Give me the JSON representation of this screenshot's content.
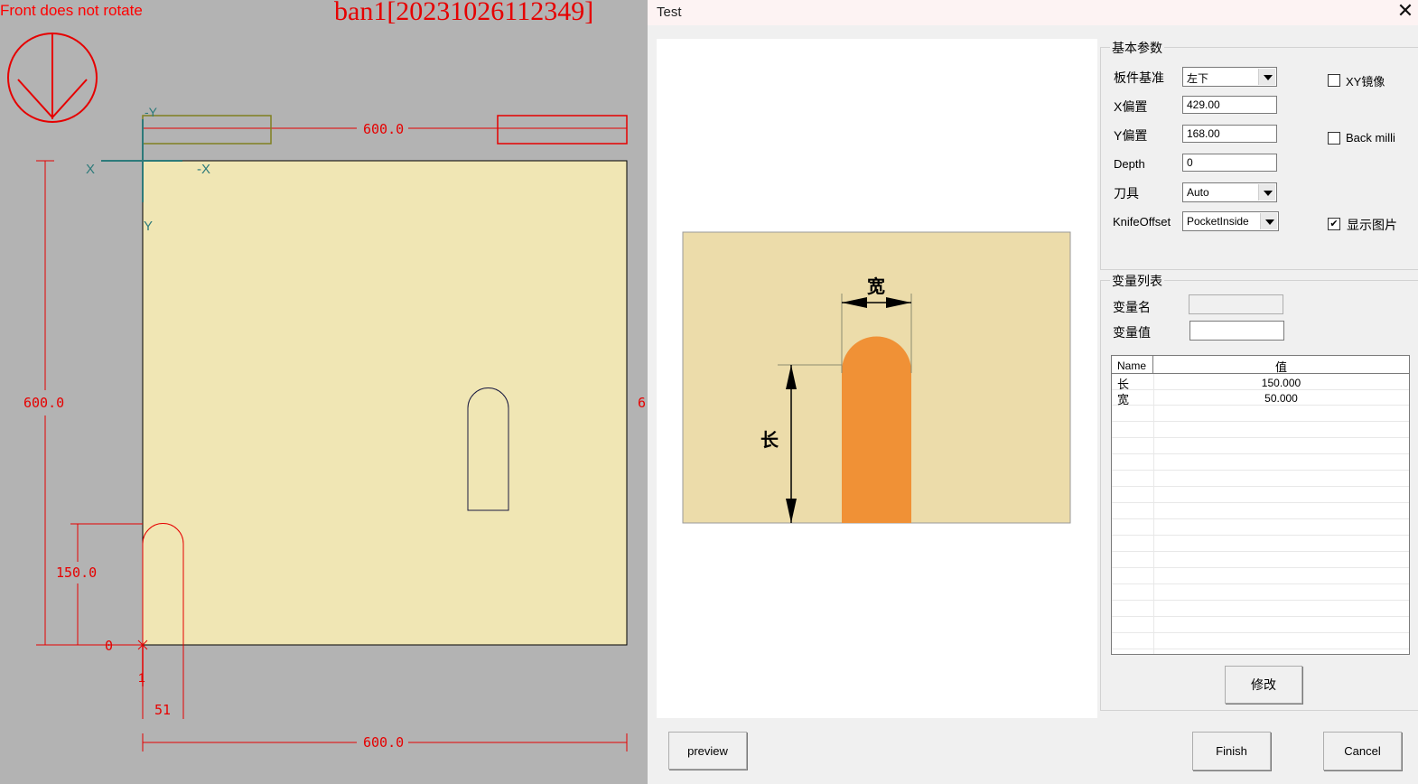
{
  "canvas": {
    "top_note": "Front does not rotate",
    "title": "ban1[20231026112349]",
    "axis": {
      "neg_y": "-Y",
      "x": "X",
      "neg_x": "-X",
      "y": "Y"
    },
    "dims": {
      "top_width": "600.0",
      "left_height": "600.0",
      "slot_height": "150.0",
      "origin": "0",
      "slot_x": "51",
      "bottom_width": "600.0",
      "right_partial": "6",
      "small_mark": "1"
    },
    "colors": {
      "panel": "#f0e6b4",
      "dim": "#e60000",
      "axis": "#2d7a7a",
      "tool": "#808020"
    }
  },
  "dialog": {
    "title": "Test",
    "preview_labels": {
      "width": "宽",
      "length": "长"
    },
    "preview_colors": {
      "bg": "#ecdcaa",
      "slot": "#f09136"
    },
    "basic_params": {
      "legend": "基本参数",
      "board_ref_label": "板件基准",
      "board_ref_value": "左下",
      "x_offset_label": "X偏置",
      "x_offset_value": "429.00",
      "y_offset_label": "Y偏置",
      "y_offset_value": "168.00",
      "depth_label": "Depth",
      "depth_value": "0",
      "tool_label": "刀具",
      "tool_value": "Auto",
      "knife_offset_label": "KnifeOffset",
      "knife_offset_value": "PocketInside",
      "xy_mirror_label": "XY镜像",
      "xy_mirror_checked": false,
      "back_mill_label": "Back milli",
      "back_mill_checked": false,
      "show_image_label": "显示图片",
      "show_image_checked": true
    },
    "variables": {
      "legend": "变量列表",
      "name_label": "变量名",
      "name_value": "",
      "value_label": "变量值",
      "value_value": "",
      "columns": [
        "Name",
        "值"
      ],
      "rows": [
        {
          "name": "长",
          "value": "150.000"
        },
        {
          "name": "宽",
          "value": "50.000"
        }
      ],
      "modify_button": "修改"
    },
    "buttons": {
      "preview": "preview",
      "finish": "Finish",
      "cancel": "Cancel"
    }
  }
}
